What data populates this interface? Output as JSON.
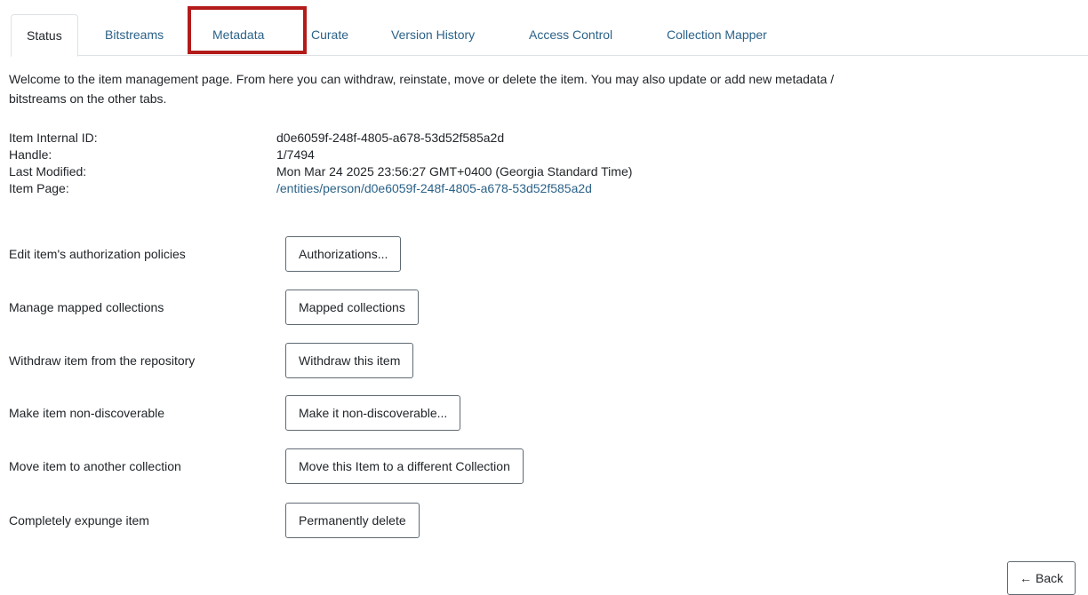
{
  "tabs": [
    {
      "label": "Status",
      "active": true
    },
    {
      "label": "Bitstreams"
    },
    {
      "label": "Metadata"
    },
    {
      "label": "Curate"
    },
    {
      "label": "Version History"
    },
    {
      "label": "Access Control"
    },
    {
      "label": "Collection Mapper"
    }
  ],
  "welcome": {
    "line1": "Welcome to the item management page. From here you can withdraw, reinstate, move or delete the item. You may also update or add new metadata /",
    "line2": "bitstreams on the other tabs."
  },
  "item_info": [
    {
      "label": "Item Internal ID:",
      "value": "d0e6059f-248f-4805-a678-53d52f585a2d"
    },
    {
      "label": "Handle:",
      "value": "1/7494"
    },
    {
      "label": "Last Modified:",
      "value": "Mon Mar 24 2025 23:56:27 GMT+0400 (Georgia Standard Time)"
    },
    {
      "label": "Item Page:",
      "value": "/entities/person/d0e6059f-248f-4805-a678-53d52f585a2d"
    }
  ],
  "actions": [
    {
      "label": "Edit item's authorization policies",
      "button": "Authorizations..."
    },
    {
      "label": "Manage mapped collections",
      "button": "Mapped collections"
    },
    {
      "label": "Withdraw item from the repository",
      "button": "Withdraw this item"
    },
    {
      "label": "Make item non-discoverable",
      "button": "Make it non-discoverable..."
    },
    {
      "label": "Move item to another collection",
      "button": "Move this Item to a different Collection"
    },
    {
      "label": "Completely expunge item",
      "button": "Permanently delete"
    }
  ],
  "back": {
    "arrow": "←",
    "label": "Back"
  },
  "colors": {
    "link": "#2b6288",
    "highlight": "#b31b1b",
    "text": "#212529"
  }
}
